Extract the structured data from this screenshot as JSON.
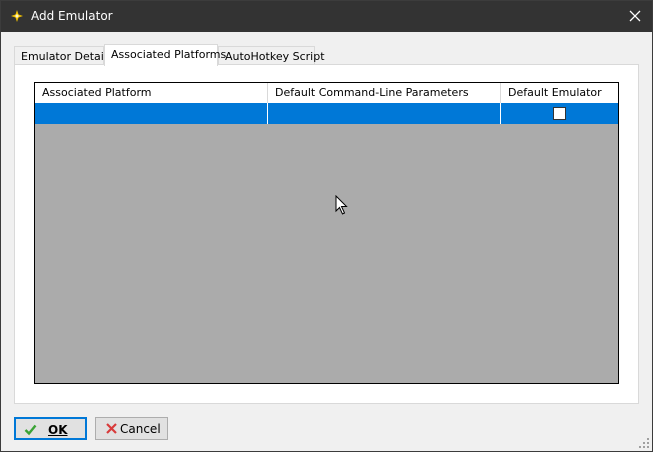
{
  "window": {
    "title": "Add Emulator",
    "close_icon": "close-icon"
  },
  "tabs": [
    {
      "label": "Emulator Details",
      "active": false
    },
    {
      "label": "Associated Platforms",
      "active": true
    },
    {
      "label": "AutoHotkey Script",
      "active": false
    }
  ],
  "grid": {
    "columns": [
      "Associated Platform",
      "Default Command-Line Parameters",
      "Default Emulator"
    ],
    "rows": [
      {
        "platform": "",
        "parameters": "",
        "default_emulator": false,
        "selected": true
      }
    ]
  },
  "buttons": {
    "ok_label": "OK",
    "cancel_label": "Cancel"
  },
  "colors": {
    "titlebar": "#333333",
    "selection": "#0078d7",
    "grid_background": "#ababab"
  }
}
